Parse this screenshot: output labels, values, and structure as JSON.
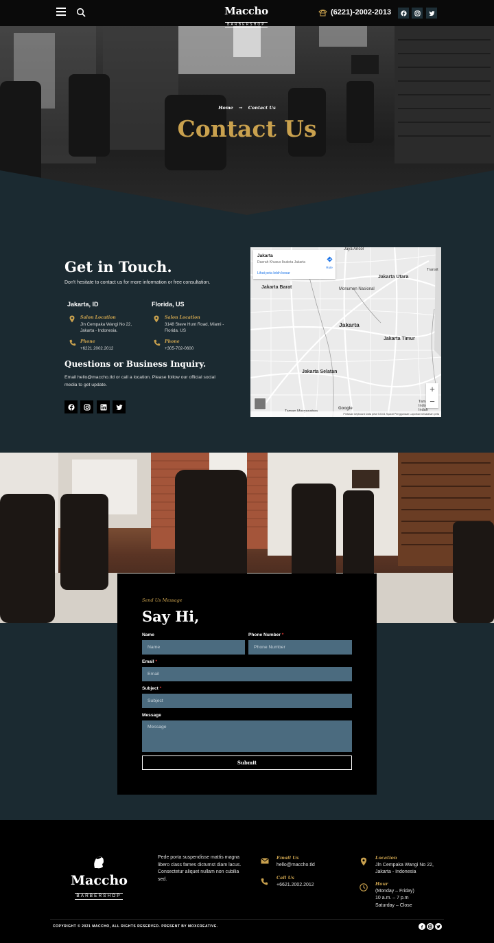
{
  "header": {
    "brand": "Maccho",
    "brand_sub": "BARBERSHOP",
    "phone": "(6221)-2002-2013",
    "social": [
      "facebook-icon",
      "instagram-icon",
      "twitter-icon"
    ]
  },
  "hero": {
    "breadcrumb_home": "Home",
    "breadcrumb_sep": "→",
    "breadcrumb_current": "Contact Us",
    "title": "Contact Us"
  },
  "contact": {
    "title": "Get in Touch.",
    "description": "Don't hesitate to contact us for more information or free consultation.",
    "offices": [
      {
        "city": "Jakarta, ID",
        "location_label": "Salon Location",
        "address_line1": "Jln Cempaka Wangi No 22,",
        "address_line2": "Jakarta - Indonesia.",
        "phone_label": "Phone",
        "phone": "+6221.2002.2012"
      },
      {
        "city": "Florida, US",
        "location_label": "Salon Location",
        "address_line1": "3148 Steve Hunt Road, Miami -",
        "address_line2": "Florida. US",
        "phone_label": "Phone",
        "phone": "+305-702-0600"
      }
    ],
    "inquiry_title": "Questions or Business Inquiry.",
    "inquiry_text": "Email hello@maccho.tld or call a location. Please follow our official social media to get update.",
    "social": [
      "facebook-icon",
      "instagram-icon",
      "linkedin-icon",
      "twitter-icon"
    ]
  },
  "map": {
    "card_title": "Jakarta",
    "card_subtitle": "Daerah Khusus Ibukota Jakarta",
    "card_link": "Lihat peta lebih besar",
    "route_label": "Rute",
    "places": {
      "jakarta_utara": "Jakarta Utara",
      "jakarta_barat": "Jakarta Barat",
      "monumen": "Monumen Nasional",
      "jakarta": "Jakarta",
      "jakarta_timur": "Jakarta Timur",
      "jakarta_selatan": "Jakarta Selatan",
      "jaya_ancol": "Jaya Ancol",
      "taman_mini": "Taman Mini Indonesia Indah",
      "taman_margasatwa": "Taman Margasatwa",
      "transit": "Transit"
    },
    "zoom_in": "+",
    "zoom_out": "−",
    "google": "Google",
    "footer": "Pintasan keyboard   Data peta ©2021   Syarat Penggunaan   Laporkan kesalahan peta"
  },
  "form": {
    "kicker": "Send Us Message",
    "title": "Say Hi,",
    "name_label": "Name",
    "name_placeholder": "Name",
    "phone_label": "Phone Number",
    "phone_placeholder": "Phone Number",
    "email_label": "Email",
    "email_placeholder": "Email",
    "subject_label": "Subject",
    "subject_placeholder": "Subject",
    "message_label": "Message",
    "message_placeholder": "Message",
    "required_mark": "*",
    "submit": "Submit"
  },
  "footer": {
    "brand": "Maccho",
    "brand_sub": "BARBERSHOP",
    "about": "Pede porta suspendisse mattis magna libero class fames dictumst diam lacus. Consectetur aliquet nullam non cubilia sed.",
    "email_label": "Email Us",
    "email": "hello@maccho.tld",
    "call_label": "Call Us",
    "call": "+6621.2002.2012",
    "location_label": "Location",
    "location_line1": "Jln Cempaka Wangi No 22,",
    "location_line2": "Jakarta - Indonesia",
    "hour_label": "Hour",
    "hour_line1": "(Monday – Friday)",
    "hour_line2": "10 a.m. – 7 p.m",
    "hour_line3": "Saturday – Close",
    "copyright": "COPYRIGHT © 2021 MACCHO, ALL RIGHTS RESERVED. PRESENT BY MOXCREATIVE.",
    "social": [
      "facebook-icon",
      "instagram-icon",
      "twitter-icon"
    ]
  },
  "colors": {
    "accent": "#c9a14e",
    "background": "#1b2a31",
    "input": "#4b6b7f",
    "black": "#000000"
  }
}
